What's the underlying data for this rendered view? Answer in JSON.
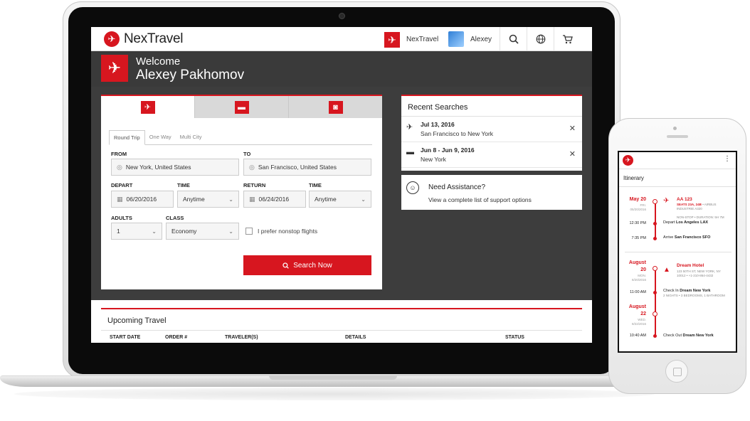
{
  "app": {
    "name": "NexTravel",
    "company": "NexTravel",
    "user_short": "Alexey",
    "brand_color": "#d7161f"
  },
  "banner": {
    "welcome": "Welcome",
    "name": "Alexey Pakhomov",
    "icon": "airplane-icon"
  },
  "booking": {
    "tabs": [
      {
        "icon": "airplane-icon",
        "active": true
      },
      {
        "icon": "bed-icon",
        "active": false
      },
      {
        "icon": "car-icon",
        "active": false
      }
    ],
    "trip_types": [
      "Round Trip",
      "One Way",
      "Multi City"
    ],
    "selected_trip_type": "Round Trip",
    "from": {
      "label": "FROM",
      "value": "New York, United States"
    },
    "to": {
      "label": "TO",
      "value": "San Francisco, United States"
    },
    "depart": {
      "label": "DEPART",
      "value": "06/20/2016"
    },
    "depart_time": {
      "label": "TIME",
      "value": "Anytime"
    },
    "return": {
      "label": "RETURN",
      "value": "06/24/2016"
    },
    "return_time": {
      "label": "TIME",
      "value": "Anytime"
    },
    "adults": {
      "label": "ADULTS",
      "value": "1"
    },
    "class": {
      "label": "CLASS",
      "value": "Economy"
    },
    "nonstop_label": "I prefer nonstop flights",
    "nonstop_checked": false,
    "search_button": "Search Now"
  },
  "recent": {
    "title": "Recent Searches",
    "items": [
      {
        "icon": "airplane-icon",
        "title": "Jul 13, 2016",
        "subtitle": "San Francisco to New York"
      },
      {
        "icon": "bed-icon",
        "title": "Jun 8 - Jun 9, 2016",
        "subtitle": "New York"
      }
    ]
  },
  "assistance": {
    "title": "Need Assistance?",
    "subtitle": "View a complete list of support options"
  },
  "upcoming": {
    "title": "Upcoming Travel",
    "columns": [
      "START DATE",
      "ORDER #",
      "TRAVELER(S)",
      "DETAILS",
      "STATUS"
    ]
  },
  "phone": {
    "title": "Itinerary",
    "events": {
      "flight": {
        "date": "May 20",
        "day": "FRI.",
        "full_date": "05/20/2016",
        "name": "AA 123",
        "seats": "SEATS 23A, 24B",
        "airline": "• AIRBUS",
        "aircraft": "INDUSTRIE A320",
        "nonstop": "NON-STOP • DURATION: 5H 7M",
        "depart_time": "12:30 PM",
        "depart_prefix": "Depart",
        "depart_city": "Los Angeles",
        "depart_code": "LAX",
        "arrive_time": "7:35 PM",
        "arrive_prefix": "Arrive",
        "arrive_city": "San Francisco",
        "arrive_code": "SFO"
      },
      "hotel": {
        "checkin_month": "August",
        "checkin_day": "20",
        "checkin_weekday": "MON.",
        "checkin_full": "8/20/2016",
        "name": "Dream Hotel",
        "address": "123 50TH ST, NEW YORK, NY",
        "zip_phone": "10012 • +1-210-864-4432",
        "nights": "2 NIGHTS • 3 BEDROOMS, 1 BATHROOM",
        "checkin_time": "11:00 AM",
        "checkin_prefix": "Check In",
        "checkin_place": "Dream New York",
        "checkout_month": "August",
        "checkout_day": "22",
        "checkout_weekday": "WED.",
        "checkout_full": "8/22/2016",
        "checkout_time": "10:40 AM",
        "checkout_prefix": "Check Out",
        "checkout_place": "Dream New York"
      }
    }
  }
}
